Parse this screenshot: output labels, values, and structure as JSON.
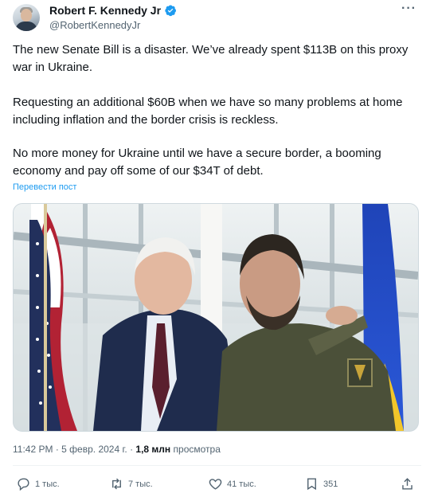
{
  "author": {
    "name": "Robert F. Kennedy Jr",
    "handle": "@RobertKennedyJr",
    "verified": true
  },
  "tweet": {
    "paragraphs": [
      "The new Senate Bill is a disaster.  We’ve already spent $113B on this proxy war in Ukraine.",
      "Requesting an additional $60B when we have so many problems at home including inflation and the border crisis is reckless.",
      "No more money for Ukraine until we have a secure border, a booming economy and pay off some of our $34T of debt."
    ],
    "translate_label": "Перевести пост"
  },
  "meta": {
    "time": "11:42 PM",
    "date": "5 февр. 2024 г.",
    "separator": "·",
    "views_count": "1,8 млн",
    "views_label": "просмотра"
  },
  "actions": {
    "reply_count": "1 тыс.",
    "retweet_count": "7 тыс.",
    "like_count": "41 тыс.",
    "bookmark_count": "351"
  },
  "colors": {
    "accent": "#1d9bf0",
    "text": "#0f1419",
    "secondary": "#536471"
  },
  "icons": [
    "verified-icon",
    "more-icon",
    "reply-icon",
    "retweet-icon",
    "like-icon",
    "bookmark-icon",
    "share-icon"
  ]
}
